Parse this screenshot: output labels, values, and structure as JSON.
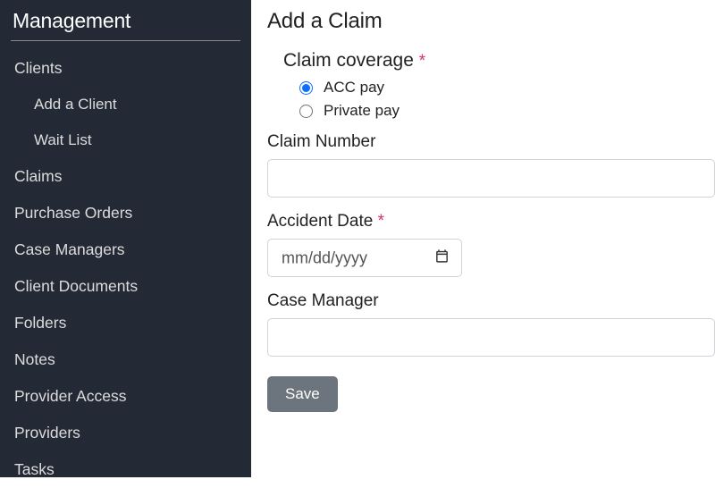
{
  "sidebar": {
    "title": "Management",
    "items": [
      {
        "label": "Clients",
        "sub": [
          {
            "label": "Add a Client"
          },
          {
            "label": "Wait List"
          }
        ]
      },
      {
        "label": "Claims"
      },
      {
        "label": "Purchase Orders"
      },
      {
        "label": "Case Managers"
      },
      {
        "label": "Client Documents"
      },
      {
        "label": "Folders"
      },
      {
        "label": "Notes"
      },
      {
        "label": "Provider Access"
      },
      {
        "label": "Providers"
      },
      {
        "label": "Tasks"
      }
    ]
  },
  "page": {
    "title": "Add a Claim"
  },
  "form": {
    "coverage": {
      "legend": "Claim coverage",
      "required_mark": "*",
      "options": [
        {
          "label": "ACC pay",
          "checked": true
        },
        {
          "label": "Private pay",
          "checked": false
        }
      ]
    },
    "claim_number": {
      "label": "Claim Number",
      "value": ""
    },
    "accident_date": {
      "label": "Accident Date",
      "required_mark": "*",
      "placeholder": "mm/dd/yyyy",
      "value": ""
    },
    "case_manager": {
      "label": "Case Manager",
      "value": ""
    },
    "save_button": "Save"
  },
  "colors": {
    "sidebar_bg": "#242a35",
    "required": "#d6336c",
    "button_bg": "#6c757d"
  }
}
